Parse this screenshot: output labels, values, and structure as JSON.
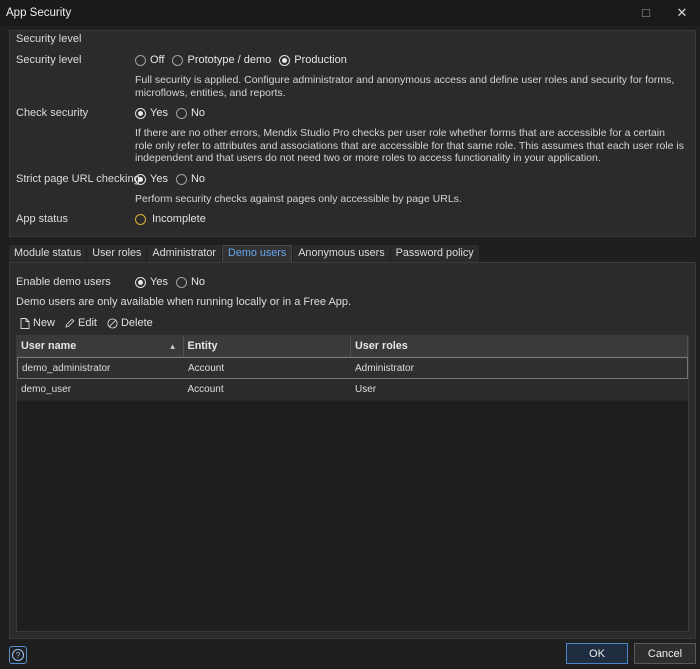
{
  "window": {
    "title": "App Security",
    "maximize_glyph": "☐",
    "close_glyph": "✕"
  },
  "security_group": {
    "legend": "Security level",
    "security_level": {
      "label": "Security level",
      "options": [
        "Off",
        "Prototype / demo",
        "Production"
      ],
      "selected": "Production",
      "description": "Full security is applied. Configure administrator and anonymous access and define user roles and security for forms, microflows, entities, and reports."
    },
    "check_security": {
      "label": "Check security",
      "options": [
        "Yes",
        "No"
      ],
      "selected": "Yes",
      "description": "If there are no other errors, Mendix Studio Pro checks per user role whether forms that are accessible for a certain role only refer to attributes and associations that are accessible for that same role. This assumes that each user role is independent and that users do not need two or more roles to access functionality in your application."
    },
    "strict_url": {
      "label": "Strict page URL checking",
      "options": [
        "Yes",
        "No"
      ],
      "selected": "Yes",
      "description": "Perform security checks against pages only accessible by page URLs."
    },
    "app_status": {
      "label": "App status",
      "value": "Incomplete",
      "status_color": "#d8b234"
    }
  },
  "tabs": [
    {
      "label": "Module status"
    },
    {
      "label": "User roles"
    },
    {
      "label": "Administrator"
    },
    {
      "label": "Demo users",
      "active": true
    },
    {
      "label": "Anonymous users"
    },
    {
      "label": "Password policy"
    }
  ],
  "demo_users": {
    "enable_label": "Enable demo users",
    "options": [
      "Yes",
      "No"
    ],
    "selected": "Yes",
    "note": "Demo users are only available when running locally or in a Free App.",
    "toolbar": {
      "new_label": "New",
      "edit_label": "Edit",
      "delete_label": "Delete"
    },
    "table": {
      "columns": [
        "User name",
        "Entity",
        "User roles"
      ],
      "sort_indicator": "▲",
      "rows": [
        [
          "demo_administrator",
          "Account",
          "Administrator"
        ],
        [
          "demo_user",
          "Account",
          "User"
        ]
      ]
    }
  },
  "footer": {
    "help_glyph": "?",
    "ok_label": "OK",
    "cancel_label": "Cancel"
  },
  "colors": {
    "accent": "#66a6ee",
    "background": "#1f1f1f",
    "panel": "#2b2b2b"
  }
}
